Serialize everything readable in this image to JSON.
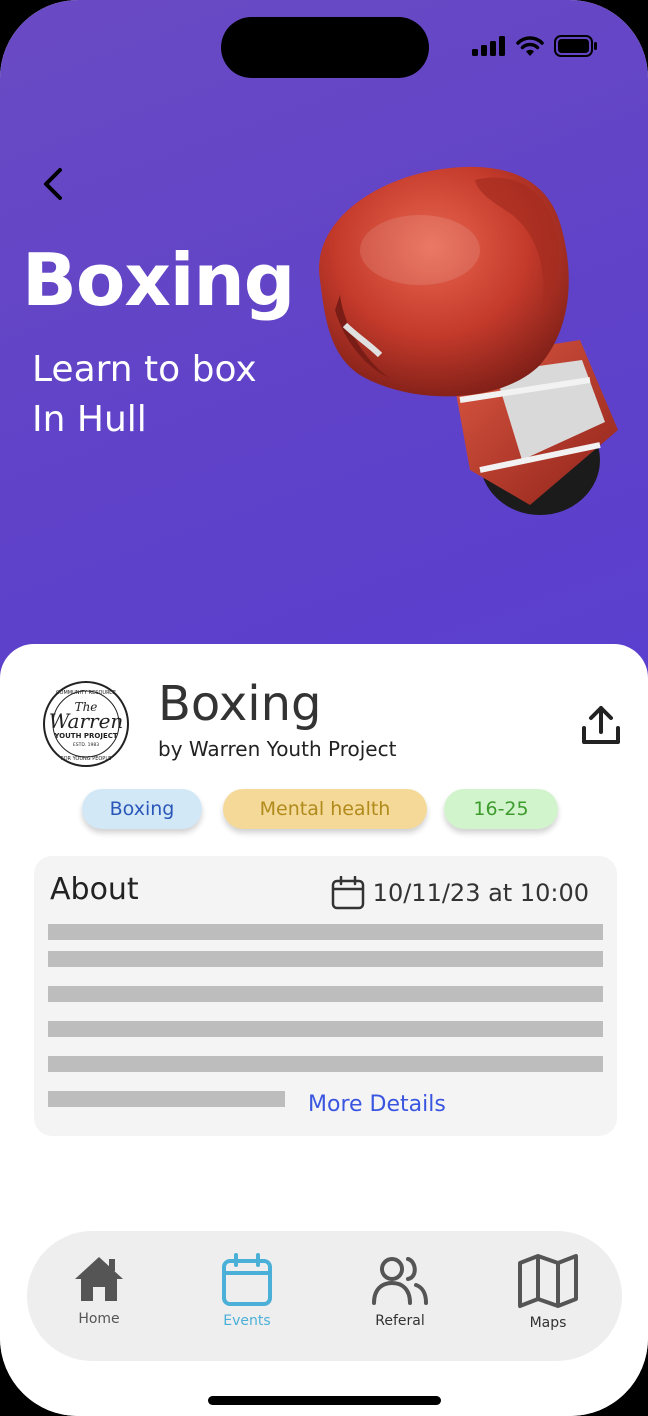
{
  "hero": {
    "title": "Boxing",
    "subtitle_line1": "Learn to box",
    "subtitle_line2": "In Hull"
  },
  "event": {
    "title": "Boxing",
    "organizer": "by Warren Youth Project",
    "logo_text": {
      "top": "COMMUNITY RESOURCE",
      "the": "The",
      "name": "Warren",
      "sub": "YOUTH PROJECT",
      "est": "ESTD. 1983",
      "bottom": "FOR YOUNG PEOPLE"
    }
  },
  "tags": [
    {
      "label": "Boxing",
      "bg": "#d2e8f7",
      "color": "#2b58b8"
    },
    {
      "label": "Mental health",
      "bg": "#f5d998",
      "color": "#b08b1c"
    },
    {
      "label": "16-25",
      "bg": "#d2f4cc",
      "color": "#3e9b2e"
    }
  ],
  "about": {
    "title": "About",
    "date": "10/11/23 at 10:00",
    "more_link": "More Details"
  },
  "nav": {
    "items": [
      {
        "label": "Home",
        "icon": "home-icon",
        "color": "#555555"
      },
      {
        "label": "Events",
        "icon": "calendar-icon",
        "color": "#4ab0d8",
        "active": true
      },
      {
        "label": "Referal",
        "icon": "users-icon",
        "color": "#555555"
      },
      {
        "label": "Maps",
        "icon": "map-icon",
        "color": "#555555"
      }
    ]
  },
  "colors": {
    "hero_bg": "#5f42c8",
    "accent": "#3a55e0",
    "active_nav": "#4ab0d8"
  }
}
